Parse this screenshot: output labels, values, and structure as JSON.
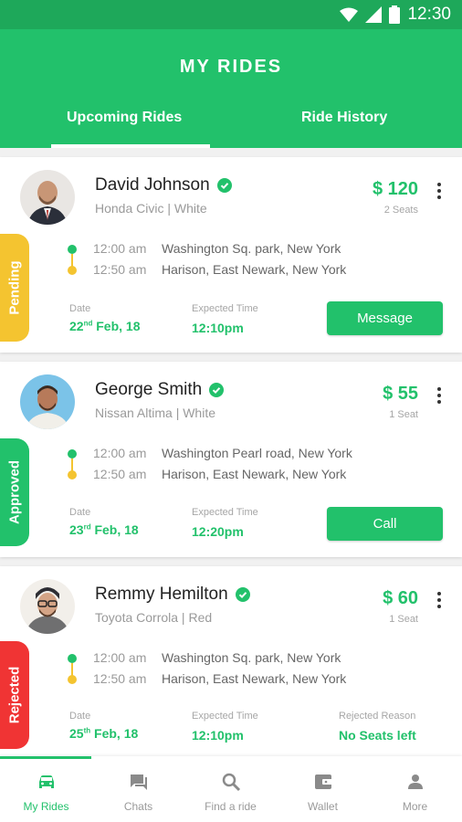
{
  "status": {
    "time": "12:30"
  },
  "header": {
    "title": "MY RIDES",
    "tabs": [
      {
        "label": "Upcoming Rides"
      },
      {
        "label": "Ride History"
      }
    ]
  },
  "colors": {
    "primary": "#22c16b",
    "pending": "#f4c430",
    "approved": "#22c16b",
    "rejected": "#f03434"
  },
  "rides": [
    {
      "status": "Pending",
      "name": "David Johnson",
      "car": "Honda Civic |  White",
      "price": "$ 120",
      "seats": "2 Seats",
      "pickup_time": "12:00 am",
      "pickup_addr": "Washington Sq. park, New York",
      "drop_time": "12:50 am",
      "drop_addr": "Harison, East Newark, New York",
      "date_label": "Date",
      "date_day": "22",
      "date_suffix": "nd",
      "date_rest": " Feb, 18",
      "expected_label": "Expected Time",
      "expected_time": "12:10pm",
      "action": "Message"
    },
    {
      "status": "Approved",
      "name": "George Smith",
      "car": "Nissan Altima  |  White",
      "price": "$ 55",
      "seats": "1 Seat",
      "pickup_time": "12:00 am",
      "pickup_addr": "Washington Pearl road, New York",
      "drop_time": "12:50 am",
      "drop_addr": "Harison, East Newark, New York",
      "date_label": "Date",
      "date_day": "23",
      "date_suffix": "rd",
      "date_rest": " Feb, 18",
      "expected_label": "Expected Time",
      "expected_time": "12:20pm",
      "action": "Call"
    },
    {
      "status": "Rejected",
      "name": "Remmy Hemilton",
      "car": "Toyota Corrola  |  Red",
      "price": "$ 60",
      "seats": "1 Seat",
      "pickup_time": "12:00 am",
      "pickup_addr": "Washington Sq. park, New York",
      "drop_time": "12:50 am",
      "drop_addr": "Harison, East Newark, New York",
      "date_label": "Date",
      "date_day": "25",
      "date_suffix": "th",
      "date_rest": " Feb, 18",
      "expected_label": "Expected Time",
      "expected_time": "12:10pm",
      "reason_label": "Rejected Reason",
      "reason": "No Seats left"
    }
  ],
  "nav": [
    {
      "label": "My Rides",
      "icon": "car-icon"
    },
    {
      "label": "Chats",
      "icon": "chat-icon"
    },
    {
      "label": "Find a ride",
      "icon": "search-icon"
    },
    {
      "label": "Wallet",
      "icon": "wallet-icon"
    },
    {
      "label": "More",
      "icon": "person-icon"
    }
  ]
}
